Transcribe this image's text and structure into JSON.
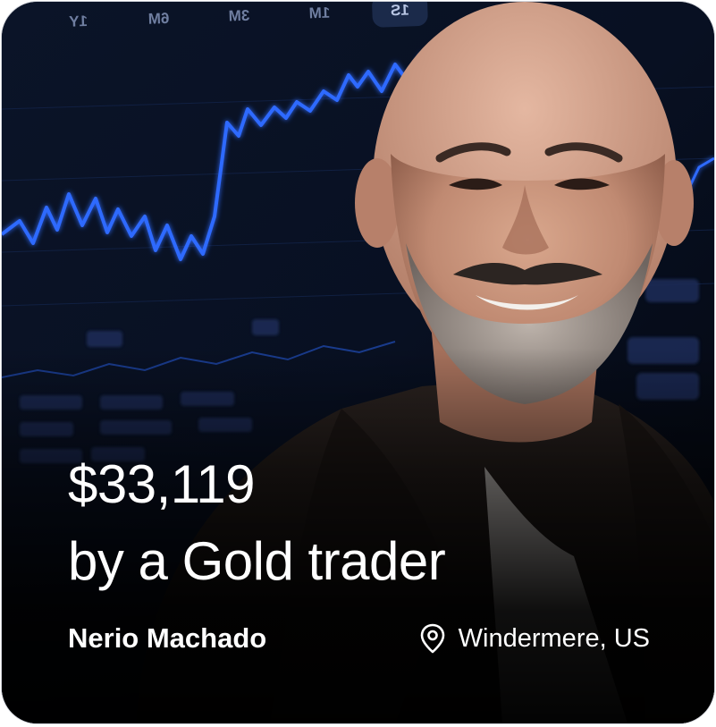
{
  "chart_tabs": [
    "1Y",
    "6M",
    "3M",
    "1M",
    "1S"
  ],
  "card": {
    "amount": "$33,119",
    "subtitle": "by a Gold trader",
    "trader_name": "Nerio Machado",
    "location": "Windermere, US"
  },
  "icons": {
    "location": "map-pin-icon"
  },
  "colors": {
    "background": "#05070d",
    "chart_line": "#2f6bff",
    "text": "#ffffff"
  }
}
